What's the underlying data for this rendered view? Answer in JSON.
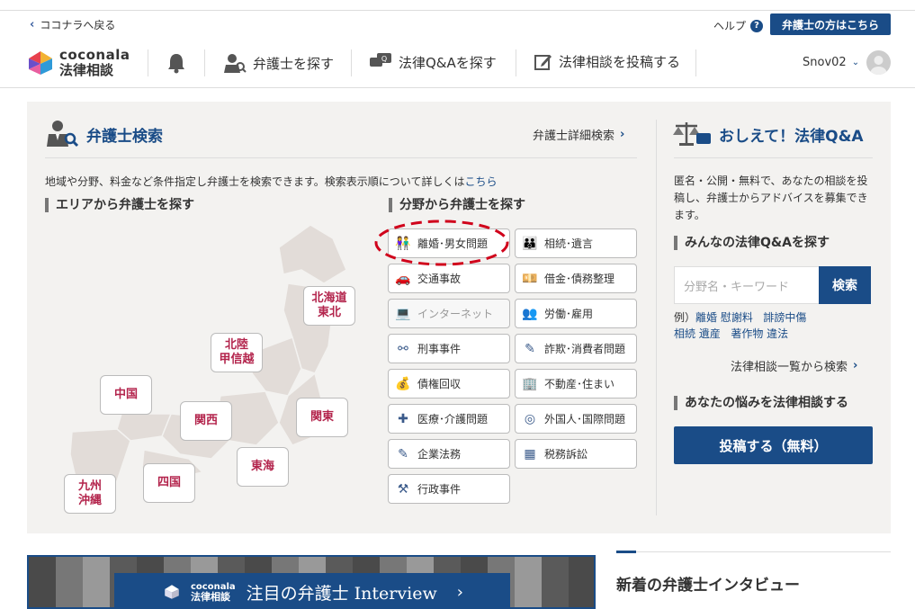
{
  "header": {
    "back_label": "ココナラへ戻る",
    "help_label": "ヘルプ",
    "lawyer_button": "弁護士の方はこちら",
    "logo_brand": "coconala",
    "logo_sub": "法律相談",
    "nav": {
      "find_lawyer": "弁護士を探す",
      "find_qa": "法律Q&Aを探す",
      "post": "法律相談を投稿する"
    },
    "username": "Snov02"
  },
  "lawyer_search": {
    "title": "弁護士検索",
    "detail_link": "弁護士詳細検索",
    "description": "地域や分野、料金など条件指定し弁護士を検索できます。検索表示順について詳しくは",
    "description_link": "こちら",
    "area_heading": "エリアから弁護士を探す",
    "field_heading": "分野から弁護士を探す",
    "regions": {
      "hokkaido": "北海道\n東北",
      "hokuriku": "北陸\n甲信越",
      "chugoku": "中国",
      "kansai": "関西",
      "kanto": "関東",
      "tokai": "東海",
      "shikoku": "四国",
      "kyushu": "九州\n沖縄"
    },
    "categories": [
      {
        "label": "離婚･男女問題",
        "icon": "couple-icon"
      },
      {
        "label": "相続･遺言",
        "icon": "family-icon"
      },
      {
        "label": "交通事故",
        "icon": "car-icon"
      },
      {
        "label": "借金･債務整理",
        "icon": "debt-icon"
      },
      {
        "label": "インターネット",
        "icon": "computer-icon"
      },
      {
        "label": "労働･雇用",
        "icon": "worker-icon"
      },
      {
        "label": "刑事事件",
        "icon": "handcuffs-icon"
      },
      {
        "label": "詐欺･消費者問題",
        "icon": "fraud-icon"
      },
      {
        "label": "債権回収",
        "icon": "money-bag-icon"
      },
      {
        "label": "不動産･住まい",
        "icon": "building-icon"
      },
      {
        "label": "医療･介護問題",
        "icon": "medical-icon"
      },
      {
        "label": "外国人･国際問題",
        "icon": "globe-icon"
      },
      {
        "label": "企業法務",
        "icon": "document-icon"
      },
      {
        "label": "税務訴訟",
        "icon": "calculator-icon"
      },
      {
        "label": "行政事件",
        "icon": "gavel-icon"
      }
    ]
  },
  "qa": {
    "title": "おしえて！法律Q&A",
    "description": "匿名・公開・無料で、あなたの相談を投稿し、弁護士からアドバイスを募集できます。",
    "find_heading": "みんなの法律Q&Aを探す",
    "search_placeholder": "分野名・キーワード",
    "search_button": "検索",
    "example_prefix": "例）",
    "examples_row1": [
      "離婚",
      "慰謝料",
      "誹謗中傷"
    ],
    "examples_row2": [
      "相続",
      "遺産",
      "著作物",
      "違法"
    ],
    "list_link": "法律相談一覧から検索",
    "post_heading": "あなたの悩みを法律相談する",
    "post_button": "投稿する（無料）"
  },
  "banner": {
    "brand": "coconala",
    "sub": "法律相談",
    "text": "注目の弁護士 Interview"
  },
  "interview": {
    "title": "新着の弁護士インタビュー"
  },
  "colors": {
    "accent": "#1a4c87",
    "region_text": "#b3244c",
    "highlight_circle": "#d0021b"
  }
}
